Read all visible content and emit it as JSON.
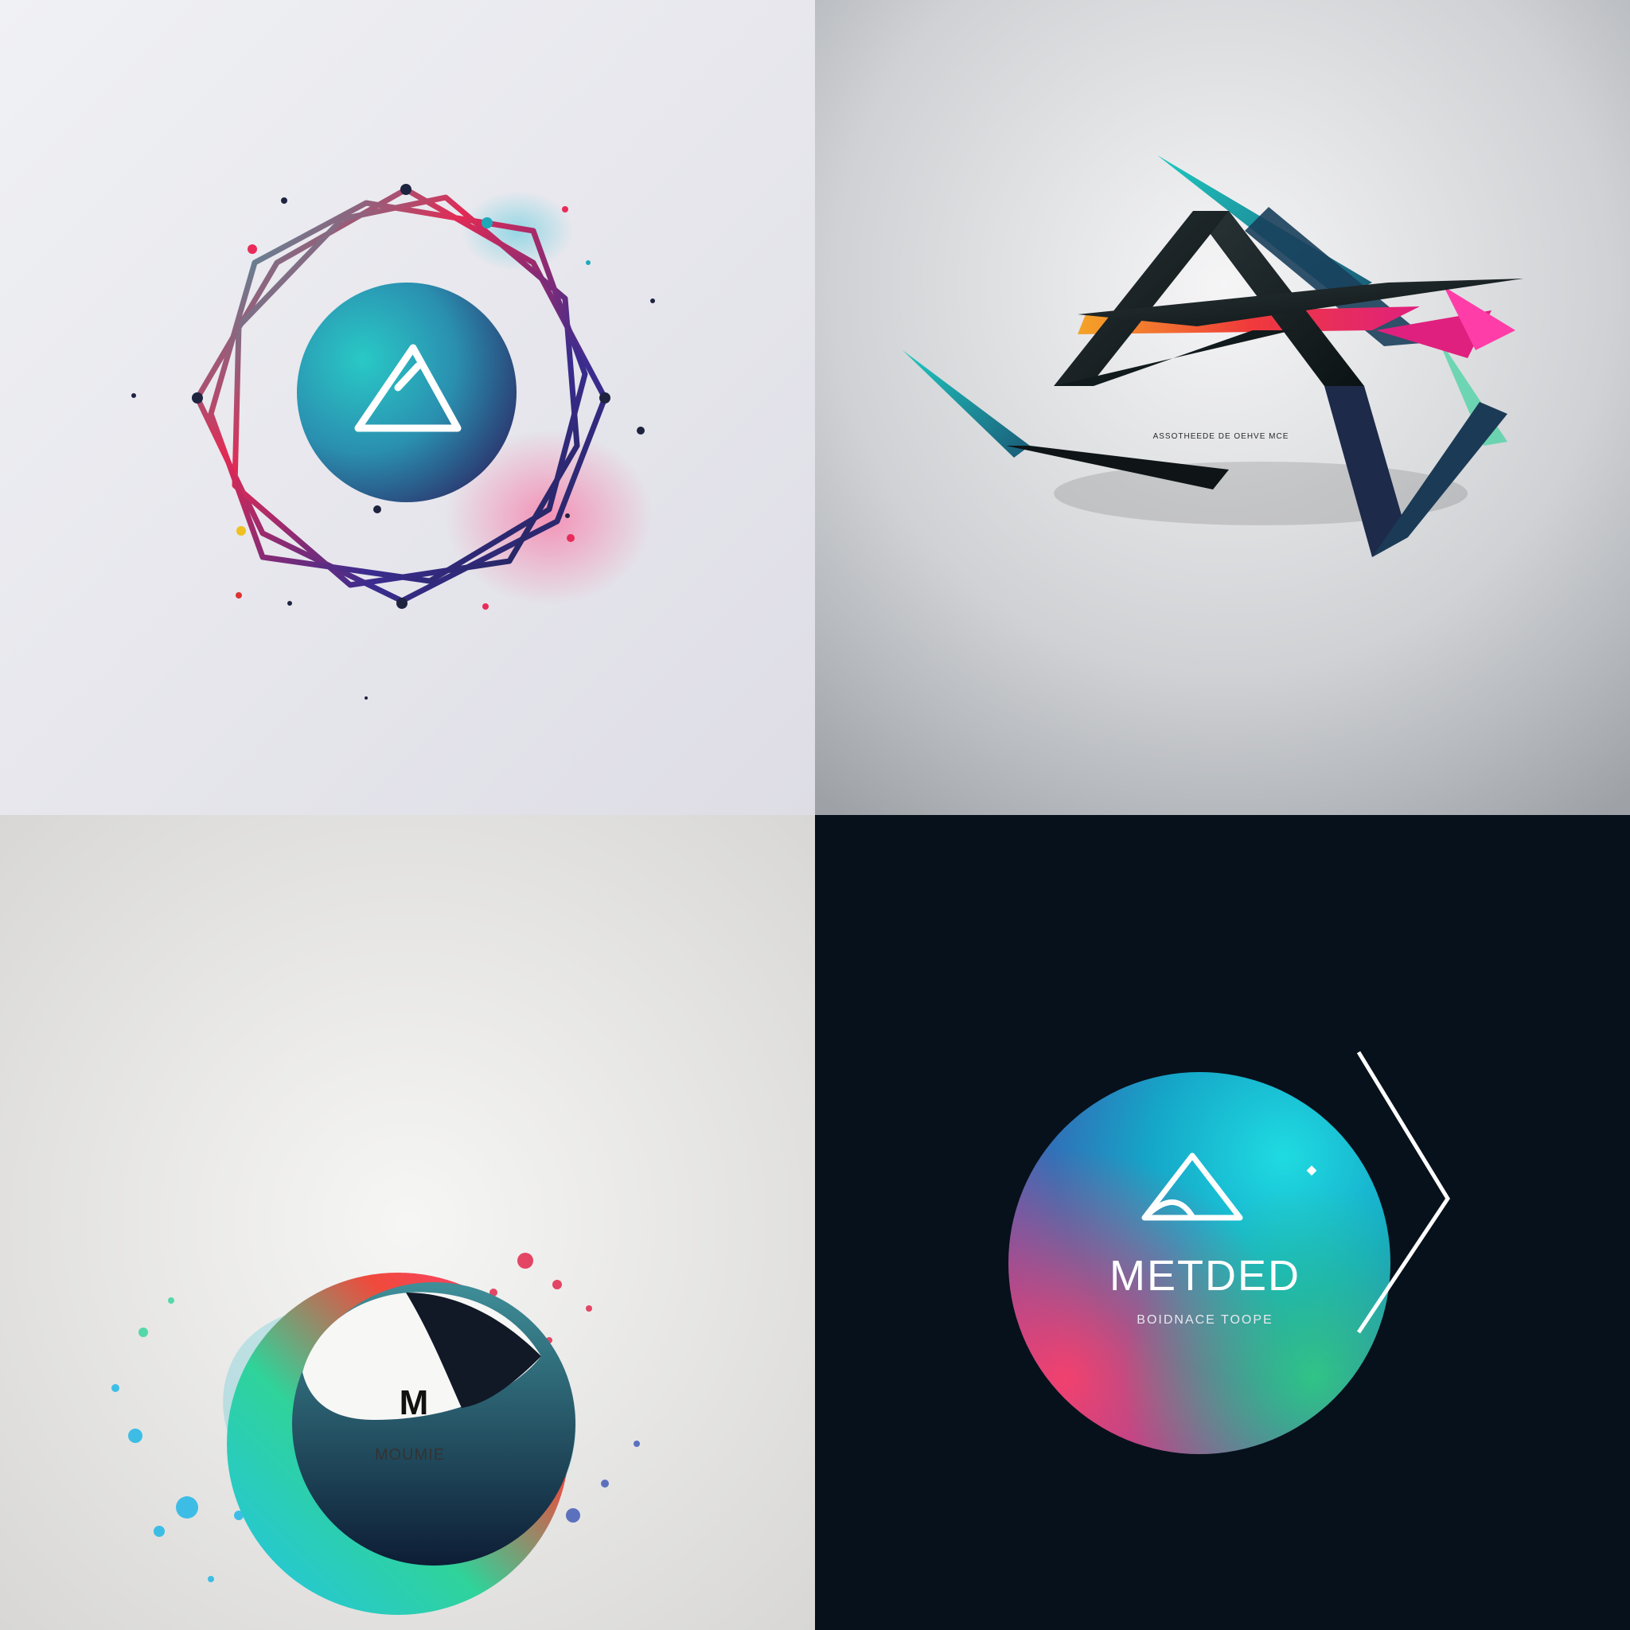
{
  "panels": [
    {
      "id": "p1",
      "mark": "triangle-circle",
      "text": ""
    },
    {
      "id": "p2",
      "mark": "angular-chevrons",
      "tagline": "ASSOTHEEDE DE OEHVE MCE"
    },
    {
      "id": "p3",
      "mark": "splash-circle",
      "monogram": "M",
      "name": "MOUMIE"
    },
    {
      "id": "p4",
      "mark": "gradient-circle",
      "name": "METDED",
      "tagline": "BOIDNACE TOOPE"
    }
  ],
  "colors": {
    "teal": "#18c4c8",
    "navy": "#1f2a57",
    "magenta": "#ee3a7a",
    "purple": "#5b2b9b",
    "dark_bg": "#07111b",
    "light_bg": "#eeeff2"
  }
}
